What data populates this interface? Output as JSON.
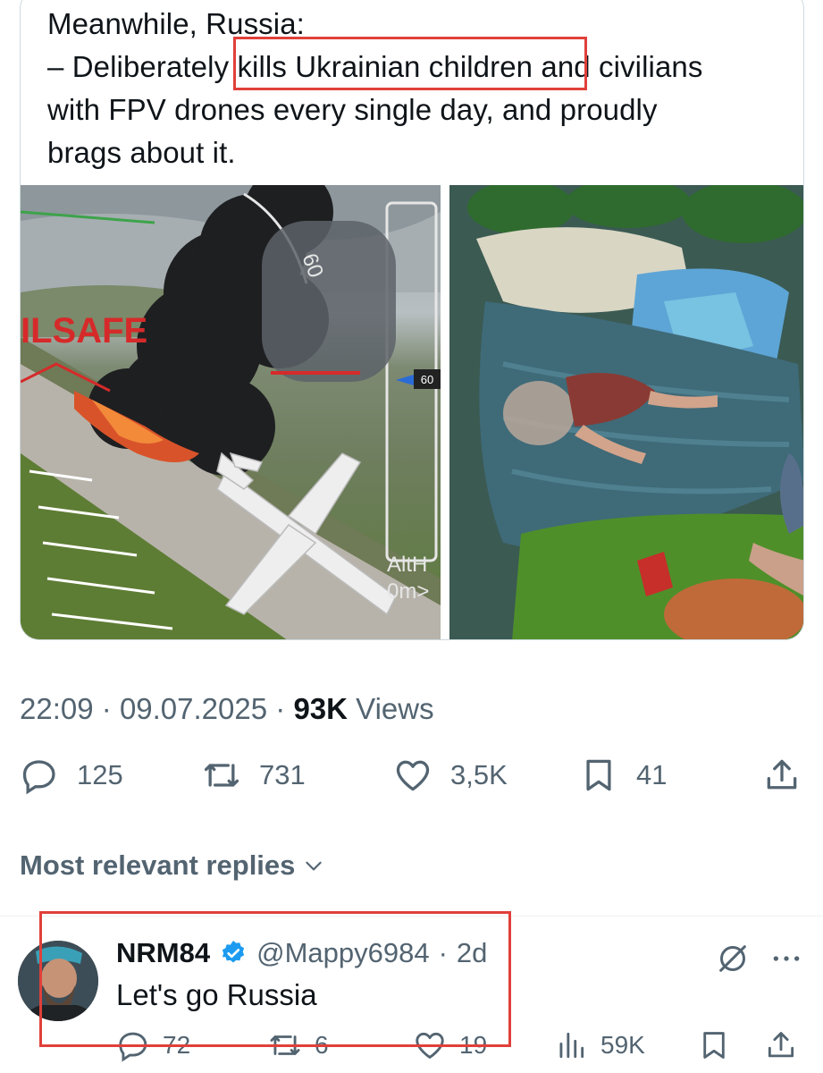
{
  "quote": {
    "lines": [
      "Meanwhile, Russia:",
      "– Deliberately kills Ukrainian children and civilians",
      "with FPV drones every single day, and proudly",
      "brags about it."
    ],
    "media": {
      "left_overlay_texts": [
        "ILSAFE",
        "60",
        "60",
        "AltH",
        "0m>"
      ],
      "left_icon": "airplane-burning",
      "right_icon": "child-on-blanket-blurred"
    }
  },
  "meta": {
    "time": "22:09",
    "date": "09.07.2025",
    "views_count": "93K",
    "views_label": "Views"
  },
  "actions": {
    "replies": "125",
    "reposts": "731",
    "likes": "3,5K",
    "bookmarks": "41"
  },
  "replies_filter": "Most relevant replies",
  "reply": {
    "name": "NRM84",
    "handle": "@Mappy6984",
    "age": "2d",
    "text": "Let's go Russia",
    "replies": "72",
    "reposts": "6",
    "likes": "19",
    "views": "59K"
  },
  "colors": {
    "highlight": "#e0403a",
    "text": "#0f1419",
    "muted": "#536471",
    "verified": "#1d9bf0",
    "border": "#cfd9de"
  }
}
